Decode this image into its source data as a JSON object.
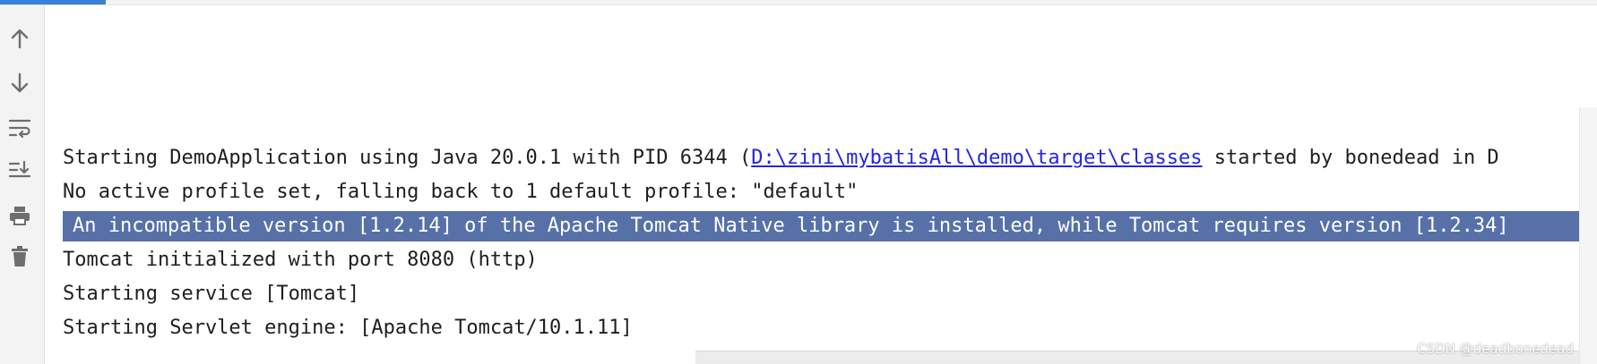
{
  "toolbar": {
    "buttons": [
      {
        "icon": "arrow-up-icon"
      },
      {
        "icon": "arrow-down-icon"
      },
      {
        "icon": "soft-wrap-icon"
      },
      {
        "icon": "scroll-to-end-icon"
      },
      {
        "icon": "print-icon"
      },
      {
        "icon": "trash-icon"
      }
    ]
  },
  "console": {
    "line1": {
      "prefix": "Starting DemoApplication using Java 20.0.1 with PID 6344 (",
      "link": "D:\\zini\\mybatisAll\\demo\\target\\classes",
      "suffix": " started by bonedead in D"
    },
    "line2": "No active profile set, falling back to 1 default profile: \"default\"",
    "line3": "An incompatible version [1.2.14] of the Apache Tomcat Native library is installed, while Tomcat requires version [1.2.34]",
    "line4": "Tomcat initialized with port 8080 (http)",
    "line5": "Starting service [Tomcat]",
    "line6": "Starting Servlet engine: [Apache Tomcat/10.1.11]"
  },
  "watermark": "CSDN @deadbonedead",
  "colors": {
    "selection": "#5771a8",
    "link": "#2424e8",
    "accent": "#3d7fd6"
  }
}
